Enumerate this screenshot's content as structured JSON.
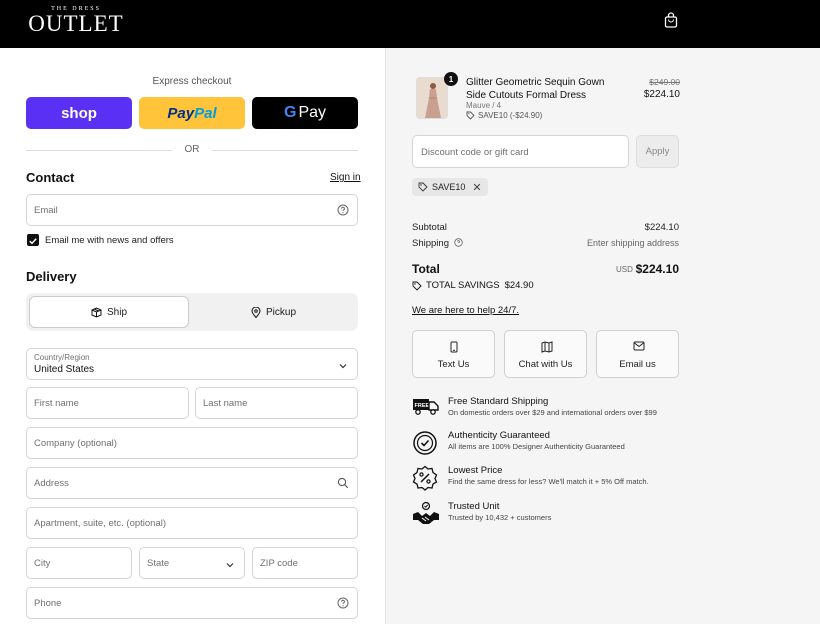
{
  "header": {
    "logo_top": "THE DRESS",
    "logo_main": "OUTLET"
  },
  "express": {
    "label": "Express checkout",
    "shop_label": "shop",
    "paypal_part1": "Pay",
    "paypal_part2": "Pal",
    "gpay_g": "G",
    "gpay_label": "Pay",
    "or_label": "OR"
  },
  "contact": {
    "title": "Contact",
    "signin_label": "Sign in",
    "email_placeholder": "Email",
    "newsletter_label": "Email me with news and offers",
    "newsletter_checked": true
  },
  "delivery": {
    "title": "Delivery",
    "ship_label": "Ship",
    "pickup_label": "Pickup",
    "selected": "Ship",
    "country_label": "Country/Region",
    "country_value": "United States",
    "first_name_placeholder": "First name",
    "last_name_placeholder": "Last name",
    "company_placeholder": "Company (optional)",
    "address_placeholder": "Address",
    "apartment_placeholder": "Apartment, suite, etc. (optional)",
    "city_placeholder": "City",
    "state_placeholder": "State",
    "zip_placeholder": "ZIP code",
    "phone_placeholder": "Phone"
  },
  "cart": {
    "item": {
      "quantity": "1",
      "name": "Glitter Geometric Sequin Gown Side Cutouts Formal Dress",
      "variant": "Mauve / 4",
      "discount_code": "SAVE10 (-$24.90)",
      "original_price": "$249.00",
      "price": "$224.10"
    },
    "discount_placeholder": "Discount code or gift card",
    "apply_label": "Apply",
    "applied_code": "SAVE10",
    "subtotal_label": "Subtotal",
    "subtotal_value": "$224.10",
    "shipping_label": "Shipping",
    "shipping_value": "Enter shipping address",
    "total_label": "Total",
    "total_currency": "USD",
    "total_value": "$224.10",
    "savings_label": "TOTAL SAVINGS",
    "savings_value": "$24.90"
  },
  "support": {
    "help_link": "We are here to help 24/7.",
    "buttons": [
      {
        "label": "Text Us",
        "icon": "phone-icon"
      },
      {
        "label": "Chat with Us",
        "icon": "chat-icon"
      },
      {
        "label": "Email us",
        "icon": "mail-icon"
      }
    ]
  },
  "features": [
    {
      "title": "Free Standard Shipping",
      "desc": "On domestic orders over $29 and international orders over $99",
      "icon": "truck-icon"
    },
    {
      "title": "Authenticity Guaranteed",
      "desc": "All items are 100% Designer Authenticity Guaranteed",
      "icon": "badge-check-icon"
    },
    {
      "title": "Lowest Price",
      "desc": "Find the same dress for less? We'll match it + 5% Off match.",
      "icon": "percent-icon"
    },
    {
      "title": "Trusted Unit",
      "desc": "Trusted by 10,432 + customers",
      "icon": "handshake-icon"
    }
  ],
  "colors": {
    "shop": "#5a31f4",
    "paypal": "#ffc439",
    "gpay": "#000000",
    "header": "#000000",
    "summary_bg": "#f5f5f5"
  }
}
